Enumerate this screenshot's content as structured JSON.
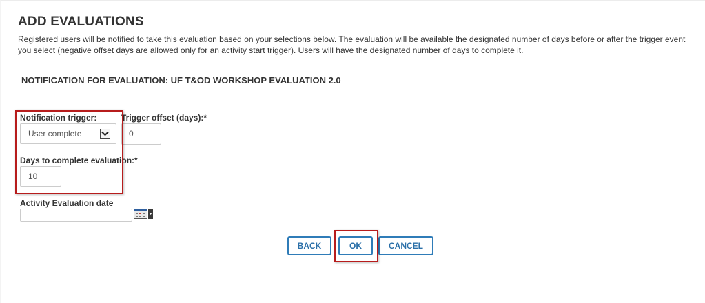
{
  "dialog": {
    "title": "ADD EVALUATIONS",
    "intro": "Registered users will be notified to take this evaluation based on your selections below. The evaluation will be available the designated number of days before or after the trigger event you select (negative offset days are allowed only for an activity start trigger). Users will have the designated number of days to complete it.",
    "subtitle": "NOTIFICATION FOR EVALUATION: UF T&OD WORKSHOP EVALUATION 2.0"
  },
  "form": {
    "trigger_label": "Notification trigger:",
    "trigger_value": "User complete",
    "offset_label": "Trigger offset (days):*",
    "offset_value": "0",
    "days_label": "Days to complete evaluation:*",
    "days_value": "10",
    "date_label": "Activity Evaluation date",
    "date_value": ""
  },
  "buttons": {
    "back": "BACK",
    "ok": "OK",
    "cancel": "CANCEL"
  },
  "icons": {
    "dropdown": "chevron-down-icon",
    "calendar": "calendar-icon"
  },
  "colors": {
    "button_accent": "#2f7cb8",
    "highlight": "#b71c1c"
  }
}
